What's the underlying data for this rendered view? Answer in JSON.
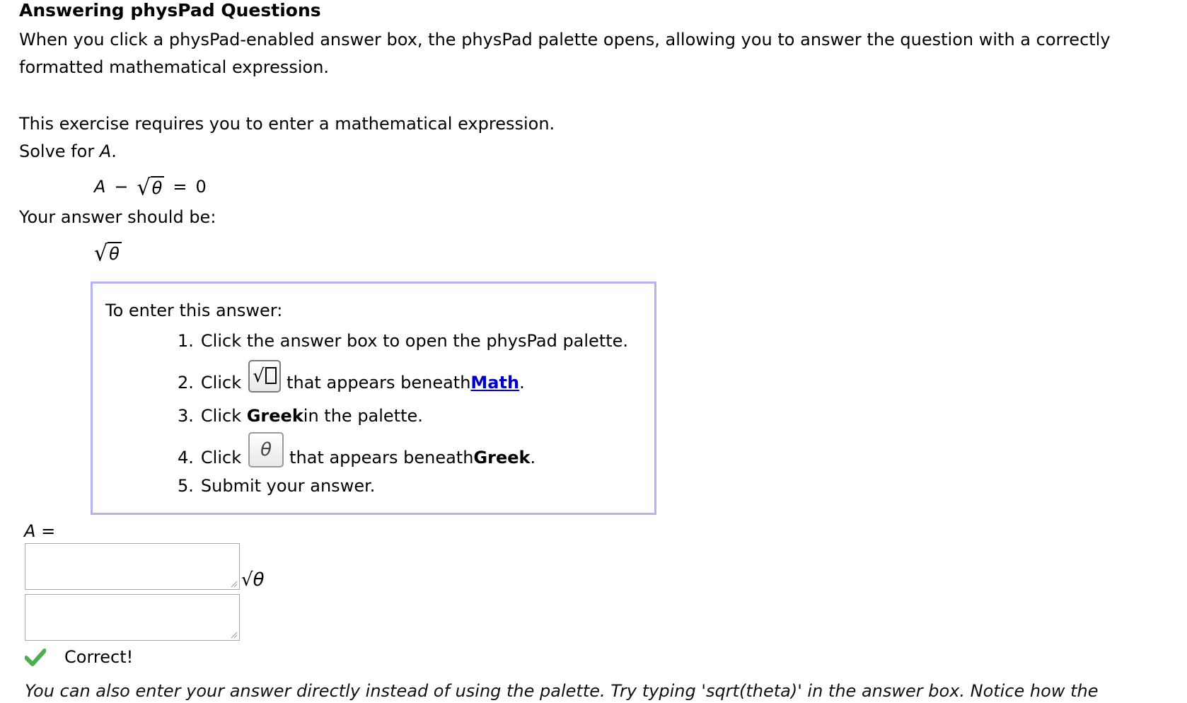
{
  "page": {
    "title": "Answering physPad Questions",
    "intro": "When you click a physPad-enabled answer box, the physPad palette opens, allowing you to answer the question with a correctly formatted mathematical expression.",
    "prompt_line1": "This exercise requires you to enter a mathematical expression.",
    "prompt_line2_prefix": "Solve for ",
    "prompt_line2_var": "A",
    "prompt_line2_suffix": "."
  },
  "equation": {
    "lhs_var": "A",
    "minus": "−",
    "radical": "√",
    "radicand": "θ",
    "equals": "=",
    "rhs": "0"
  },
  "answer_label": "Your answer should be:",
  "answer_display": {
    "radical": "√",
    "radicand": "θ"
  },
  "instructions": {
    "heading": "To enter this answer:",
    "steps": [
      {
        "num": "1.",
        "text": "Click the answer box to open the physPad palette."
      },
      {
        "num": "2.",
        "pre": "Click",
        "post": "that appears beneath ",
        "link": "Math",
        "end": ".",
        "button_icon": "sqrt-palette-icon"
      },
      {
        "num": "3.",
        "pre": "Click ",
        "bold": "Greek",
        "post": " in the palette."
      },
      {
        "num": "4.",
        "pre": "Click",
        "post": "that appears beneath ",
        "bold": "Greek",
        "end": ".",
        "button_symbol": "θ"
      },
      {
        "num": "5.",
        "text": "Submit your answer."
      }
    ]
  },
  "answer_area": {
    "var": "A",
    "equals": "=",
    "input_value": "",
    "preview": {
      "radical": "√",
      "radicand": "θ"
    }
  },
  "feedback": {
    "status_text": "Correct!",
    "status_color": "#4caf50"
  },
  "footer_note": "You can also enter your answer directly instead of using the palette. Try typing 'sqrt(theta)' in the answer box. Notice how the"
}
